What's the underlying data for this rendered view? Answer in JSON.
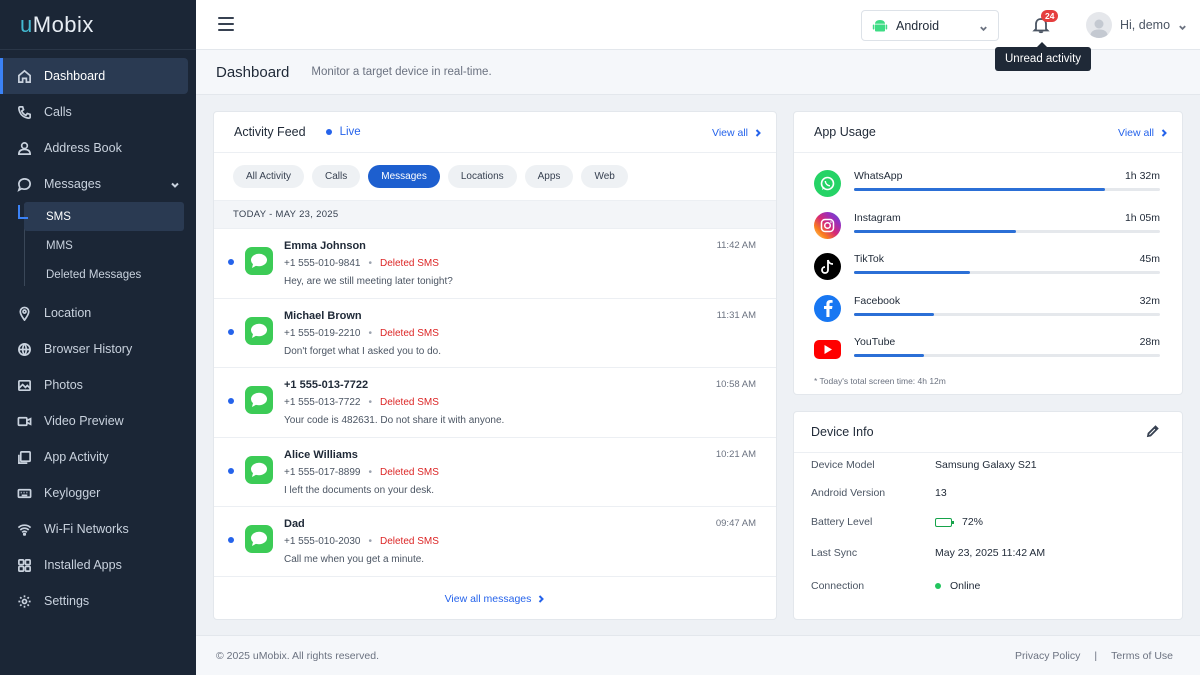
{
  "brand": {
    "part1": "u",
    "part2": "Mobix"
  },
  "sidebar": {
    "items": [
      {
        "label": "Dashboard"
      },
      {
        "label": "Calls"
      },
      {
        "label": "Address Book"
      },
      {
        "label": "Messages"
      },
      {
        "label": "Location"
      },
      {
        "label": "Browser History"
      },
      {
        "label": "Photos"
      },
      {
        "label": "Video Preview"
      },
      {
        "label": "App Activity"
      },
      {
        "label": "Keylogger"
      },
      {
        "label": "Wi-Fi Networks"
      },
      {
        "label": "Installed Apps"
      },
      {
        "label": "Settings"
      }
    ],
    "sub_items": [
      {
        "label": "SMS"
      },
      {
        "label": "MMS"
      },
      {
        "label": "Deleted Messages"
      }
    ]
  },
  "topbar": {
    "device": "Android",
    "notification_count": "24",
    "greeting": "Hi, demo",
    "tooltip": "Unread activity"
  },
  "page": {
    "title": "Dashboard",
    "subtitle": "Monitor a target device in real-time."
  },
  "feed": {
    "title": "Activity Feed",
    "live": "Live",
    "view_all": "View all",
    "filters": [
      "All Activity",
      "Calls",
      "Messages",
      "Locations",
      "Apps",
      "Web"
    ],
    "active_filter": "Messages",
    "date": "TODAY - MAY 23, 2025",
    "messages": [
      {
        "name": "Emma Johnson",
        "number": "+1 555-010-9841",
        "tag": "Deleted SMS",
        "text": "Hey, are we still meeting later tonight?",
        "time": "11:42 AM"
      },
      {
        "name": "Michael Brown",
        "number": "+1 555-019-2210",
        "tag": "Deleted SMS",
        "text": "Don't forget what I asked you to do.",
        "time": "11:31 AM"
      },
      {
        "name": "+1 555-013-7722",
        "number": "+1 555-013-7722",
        "tag": "Deleted SMS",
        "text": "Your code is 482631. Do not share it with anyone.",
        "time": "10:58 AM"
      },
      {
        "name": "Alice Williams",
        "number": "+1 555-017-8899",
        "tag": "Deleted SMS",
        "text": "I left the documents on your desk.",
        "time": "10:21 AM"
      },
      {
        "name": "Dad",
        "number": "+1 555-010-2030",
        "tag": "Deleted SMS",
        "text": "Call me when you get a minute.",
        "time": "09:47 AM"
      }
    ],
    "view_all_messages": "View all messages"
  },
  "usage": {
    "title": "App Usage",
    "view_all": "View all",
    "apps": [
      {
        "name": "WhatsApp",
        "duration": "1h 32m",
        "fraction": 0.82,
        "color": "#25d366",
        "icon": "whatsapp-icon"
      },
      {
        "name": "Instagram",
        "duration": "1h 05m",
        "fraction": 0.53,
        "color": "#d62976",
        "icon": "instagram-icon"
      },
      {
        "name": "TikTok",
        "duration": "45m",
        "fraction": 0.38,
        "color": "#000000",
        "icon": "tiktok-icon"
      },
      {
        "name": "Facebook",
        "duration": "32m",
        "fraction": 0.26,
        "color": "#1877f2",
        "icon": "facebook-icon"
      },
      {
        "name": "YouTube",
        "duration": "28m",
        "fraction": 0.23,
        "color": "#ff0000",
        "icon": "youtube-icon"
      }
    ],
    "note": "* Today's total screen time: 4h 12m"
  },
  "device_info": {
    "title": "Device Info",
    "rows": [
      {
        "label": "Device Model",
        "value": "Samsung Galaxy S21"
      },
      {
        "label": "Android Version",
        "value": "13"
      },
      {
        "label": "Battery Level",
        "value": "72%"
      },
      {
        "label": "Last Sync",
        "value": "May 23, 2025 11:42 AM"
      },
      {
        "label": "Connection",
        "value": "Online"
      }
    ],
    "battery_fraction": 0.72
  },
  "footer": {
    "copyright": "© 2025 uMobix. All rights reserved.",
    "privacy": "Privacy Policy",
    "separator": "|",
    "terms": "Terms of Use"
  }
}
